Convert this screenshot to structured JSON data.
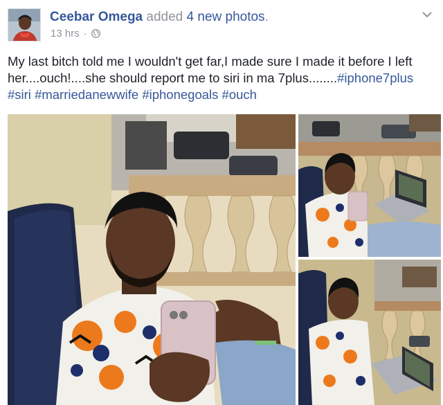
{
  "post": {
    "author": "Ceebar Omega",
    "action_text": " added ",
    "photos_link": "4 new photos",
    "action_end": ".",
    "time": "13 hrs",
    "separator": "·",
    "privacy_icon": "globe-icon",
    "menu_icon": "chevron-down-icon",
    "text_lines": [
      "My last bitch told me I wouldn't get far,I made sure I made it before I left",
      "her....ouch!....she should report me to siri in ma 7plus........"
    ],
    "hashtags": [
      "#iphone7plus",
      "#siri",
      "#marriedanewwife",
      "#iphonegoals",
      "#ouch"
    ],
    "photos": [
      "photo-1",
      "photo-2",
      "photo-3"
    ]
  },
  "colors": {
    "link": "#365899",
    "meta": "#90949c",
    "text": "#1d2129"
  }
}
